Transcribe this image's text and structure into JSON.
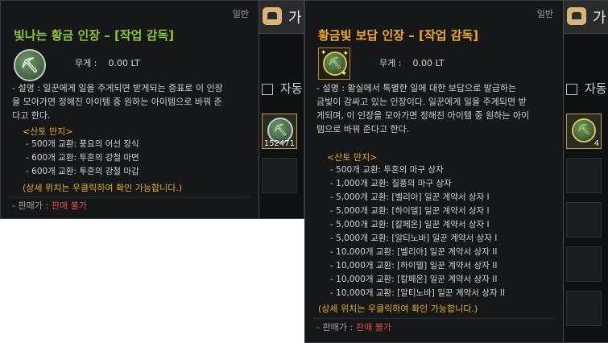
{
  "window_title": "가",
  "window_title_2": "자동",
  "panel1": {
    "grade": "일반",
    "title": "빛나는 황금 인장 – [작업 감독]",
    "weight_label": "무게 :",
    "weight_value": "0.00 LT",
    "desc_lines": [
      "- 설명 : 일꾼에게 일을 주게되면 받게되는 증표로 이 인장",
      "을 모아가면 정해진 아이템 중 원하는 아이템으로 바꿔 준",
      "다고 한다."
    ],
    "section": "<산토 만지>",
    "exchanges": [
      "500개 교환: 풍요의 어선 장식",
      "600개 교환: 투혼의 강철 마면",
      "600개 교환: 투혼의 강철 마갑"
    ],
    "note": "(상세 위치는 우클릭하여 확인 가능합니다.)",
    "price_label": "- 판매가 :",
    "price_value": "판매 불가",
    "slot_count": "152471",
    "slot_icon": "pickaxe-icon"
  },
  "panel2": {
    "grade": "일반",
    "title": "황금빛 보답 인장 – [작업 감독]",
    "weight_label": "무게 :",
    "weight_value": "0.00 LT",
    "desc_lines": [
      "- 설명 : 황실에서 특별한 일에 대한 보답으로 발급하는",
      "금빛이 감싸고 있는 인장이다. 일꾼에게 일을 주게되면 받",
      "게되며, 이 인장을 모아가면 정해진 아이템 중 원하는 아이",
      "템으로 바꿔 준다고 한다."
    ],
    "section": "<산토 만지>",
    "exchanges": [
      "500개 교환: 투혼의 마구 상자",
      "1,000개 교환: 질풍의 마구 상자",
      "5,000개 교환: [벨리아] 일꾼 계약서 상자 I",
      "5,000개 교환: [하이델] 일꾼 계약서 상자 I",
      "5,000개 교환: [칼페온] 일꾼 계약서 상자 I",
      "5,000개 교환: [알티노바] 일꾼 계약서 상자 I",
      "10,000개 교환: [벨리아] 일꾼 계약서 상자 II",
      "10,000개 교환: [하이델] 일꾼 계약서 상자 II",
      "10,000개 교환: [칼페온] 일꾼 계약서 상자 II",
      "10,000개 교환: [알티노바] 일꾼 계약서 상자 II"
    ],
    "note": "(상세 위치는 우클릭하여 확인 가능합니다.)",
    "price_label": "- 판매가 :",
    "price_value": "판매 불가",
    "slot_count": "4",
    "slot_icon": "golden-medal-icon"
  },
  "colors": {
    "title_green": "#8cc63f",
    "title_orange": "#f0a830",
    "section_gold": "#e0b030",
    "price_red": "#e04848"
  }
}
